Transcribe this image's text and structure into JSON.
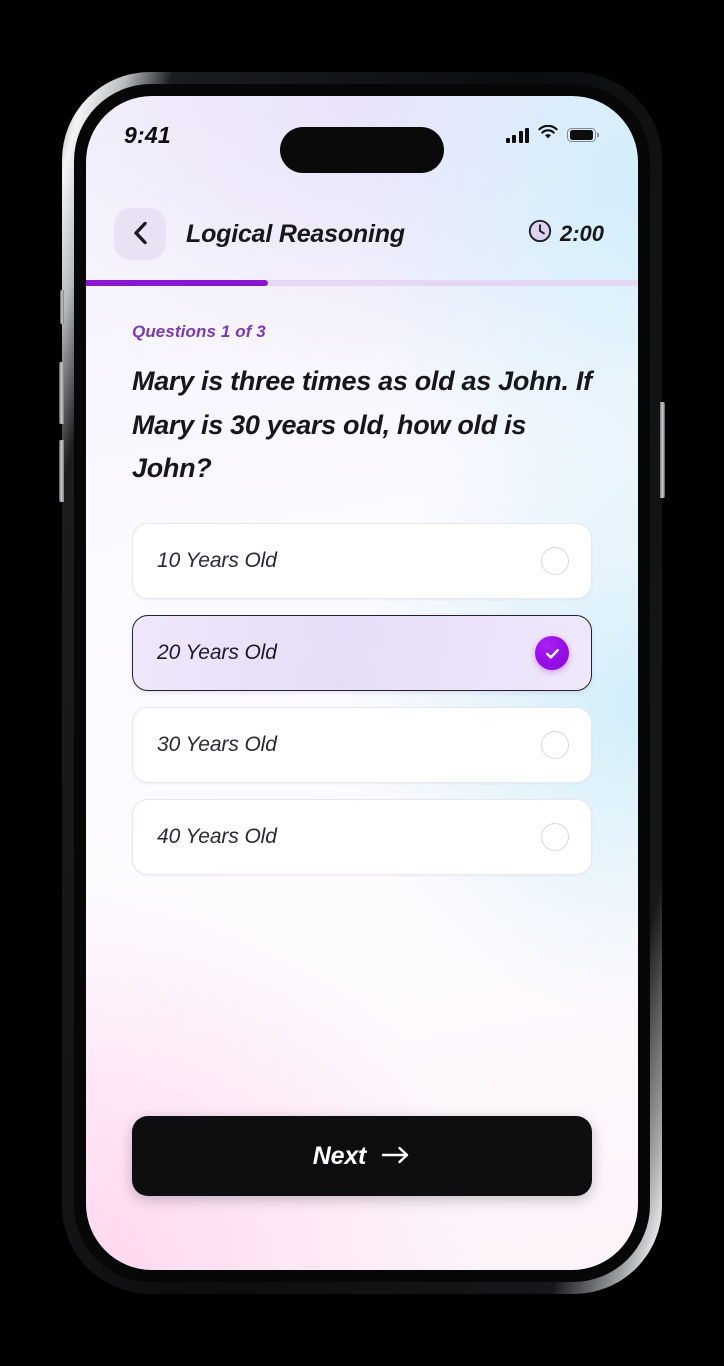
{
  "status_bar": {
    "time": "9:41",
    "signal_icon": "cellular-signal-icon",
    "wifi_icon": "wifi-icon",
    "battery_icon": "battery-icon"
  },
  "header": {
    "back_icon": "chevron-left-icon",
    "title": "Logical Reasoning",
    "timer_icon": "clock-icon",
    "timer_value": "2:00"
  },
  "progress": {
    "percent": 33,
    "fill_color": "#8b16cf",
    "track_color": "#e6d8f5"
  },
  "quiz": {
    "counter": "Questions 1 of 3",
    "question": "Mary is three times as old as John. If Mary is 30 years old, how old is John?",
    "options": [
      {
        "label": "10 Years Old",
        "selected": false
      },
      {
        "label": "20 Years Old",
        "selected": true
      },
      {
        "label": "30 Years Old",
        "selected": false
      },
      {
        "label": "40 Years Old",
        "selected": false
      }
    ],
    "selected_icon": "check-icon",
    "accent_color": "#9810e8"
  },
  "footer": {
    "next_label": "Next",
    "next_icon": "arrow-right-icon"
  }
}
